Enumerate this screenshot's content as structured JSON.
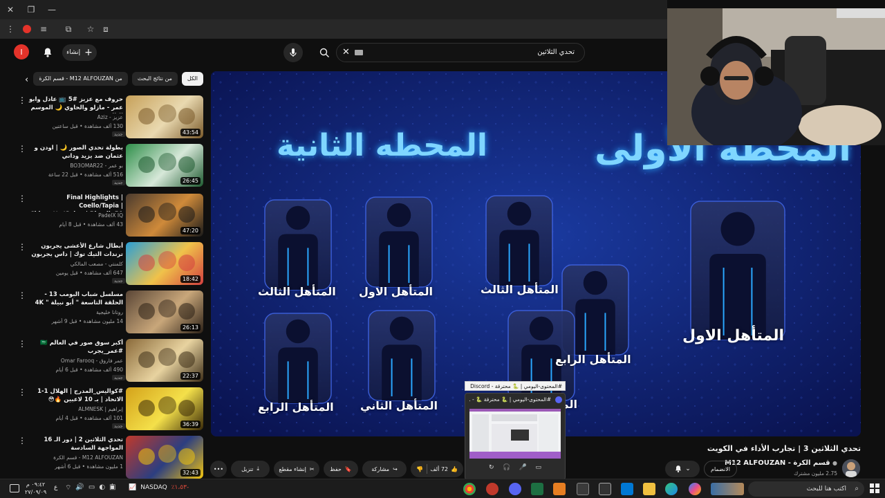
{
  "browser": {
    "window_controls": [
      "×",
      "□",
      "—"
    ]
  },
  "header": {
    "avatar_letter": "I",
    "create_label": "إنشاء",
    "search_value": "تحدي الثلاثين"
  },
  "filters": {
    "chips": [
      "الكل",
      "من نتائج البحث",
      "من M12 ALFOUZAN - قسم الكرة"
    ]
  },
  "sidebar": {
    "videos": [
      {
        "title": "حروف مع عزيز #5 📺 عادل وابو عمر - مازلو والحاوي 🌙 الموسم الثالث",
        "channel": "عزيز - Aziz",
        "meta": "130 ألف مشاهدة • قبل ساعتين",
        "badge": "جديد",
        "duration": "43:54",
        "colors": [
          "#c7a15a",
          "#e9d9b0",
          "#7a5a2a"
        ]
      },
      {
        "title": "بطولة تحدي الصور 🌙 | اودن و عثمان ضد يزيد وداني",
        "channel": "بو عمر - BO3OMAR22",
        "meta": "516 ألف مشاهدة • قبل 22 ساعة",
        "badge": "جديد",
        "duration": "26:45",
        "colors": [
          "#2f8f4a",
          "#d7e8d9",
          "#1e5a30"
        ]
      },
      {
        "title": "Final Highlights | Coello/Tapia | Chingotto/Galan | Riyadh P1 | ...",
        "channel": "PadelX IQ",
        "meta": "43 ألف مشاهدة • قبل 8 أيام",
        "badge": "",
        "duration": "47:20",
        "colors": [
          "#4b3b2e",
          "#cf8a3a",
          "#1a1a1a"
        ]
      },
      {
        "title": "أبطال شارع الأعشى يجربون ترندات التيك توك | داس يجربون",
        "channel": "كلمنتي - مصعب المالكي",
        "meta": "647 ألف مشاهدة • قبل يومين",
        "badge": "جديد",
        "duration": "18:42",
        "colors": [
          "#2a9fd6",
          "#f0c24a",
          "#d33f3f"
        ]
      },
      {
        "title": "مسلسل شباب البومب 13 - الحلقة التاسعة \" أبو نبيلة \" 4K",
        "channel": "روتانا خليجية",
        "meta": "14 مليون مشاهدة • قبل 9 أشهر",
        "badge": "",
        "duration": "26:13",
        "colors": [
          "#5a4636",
          "#c9a77a",
          "#2b2016"
        ]
      },
      {
        "title": "أكبر سوق صور في العالم 🇸🇦 #عمر_يجرب",
        "channel": "عمر فاروق - Omar Farooq",
        "meta": "490 ألف مشاهدة • قبل 6 أيام",
        "badge": "جديد",
        "duration": "22:37",
        "colors": [
          "#8a6a3a",
          "#e8d3a0",
          "#3e2f18"
        ]
      },
      {
        "title": "#كواليس_المدرج | الهلال 1-1 الاتحاد | بـ 10 لاعبين 🔥😳",
        "channel": "إبراهيم | ALMNESK",
        "meta": "101 ألف مشاهدة • قبل 4 أيام",
        "badge": "جديد",
        "duration": "36:39",
        "colors": [
          "#d4a21a",
          "#f4e04a",
          "#3a2a08"
        ]
      },
      {
        "title": "تحدي الثلاثين 2 | دور الـ 16 المواجهة السادسة",
        "channel": "M12 ALFOUZAN - قسم الكرة",
        "meta": "1 مليون مشاهدة • قبل 6 أشهر",
        "badge": "",
        "duration": "32:43",
        "colors": [
          "#c0392b",
          "#2c3e80",
          "#f1c40f"
        ]
      }
    ]
  },
  "video_frame": {
    "station_first": "المحطة الأولى",
    "station_second": "المحطه الثانية",
    "labels": {
      "s2_third": "المتأهل الثالث",
      "s2_first": "المتأهل الاول",
      "s2_fourth": "المتأهل الرابع",
      "s2_second": "المتأهل الثاني",
      "s1_third": "المتأهل الثالث",
      "s1_fourth": "المتأهل الرابع",
      "s1_first": "المتأهل الاول",
      "s1_partial": "الم"
    }
  },
  "video_info": {
    "title": "تحدي الثلاثين 3 | تجارب الأداء في الكويت",
    "channel_name": "قسم الكرة - M12 ALFOUZAN",
    "subscribers": "2.75 مليون مشترك",
    "join_label": "الانضمام",
    "likes": "72 ألف",
    "share_label": "مشاركة",
    "save_label": "حفظ",
    "clip_label": "إنشاء مقطع",
    "download_label": "تنزيل"
  },
  "discord": {
    "tooltip": "#المحتوى-اليومي | 🐍 محترقة - Discord",
    "window_title": "#المحتوى-اليومي | 🐍 محترقة 🐍 - ..."
  },
  "taskbar": {
    "search_placeholder": "اكتب هنا للبحث",
    "ticker_name": "NASDAQ",
    "ticker_value": "٪١،٥٣-",
    "time": "٠٩:٤٢ م",
    "date": "٢٧/٠٩/٠٩",
    "lang": "ع"
  }
}
